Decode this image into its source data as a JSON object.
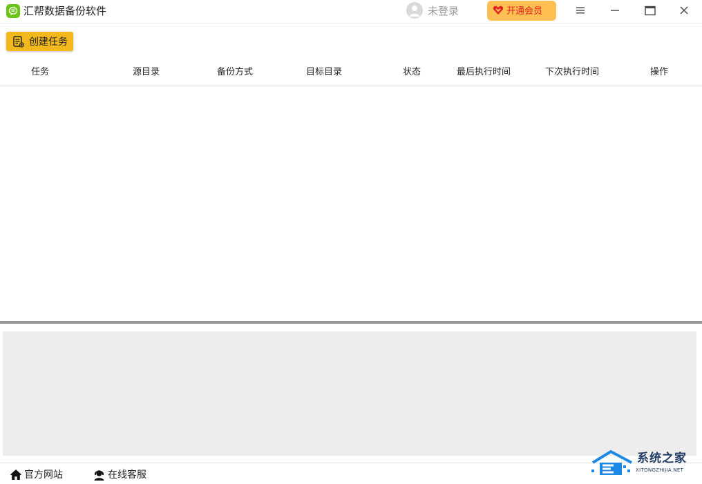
{
  "app": {
    "title": "汇帮数据备份软件"
  },
  "header": {
    "login_text": "未登录",
    "vip_label": "开通会员"
  },
  "toolbar": {
    "create_task_label": "创建任务"
  },
  "table": {
    "columns": [
      "任务",
      "源目录",
      "备份方式",
      "目标目录",
      "状态",
      "最后执行时间",
      "下次执行时间",
      "操作"
    ],
    "rows": []
  },
  "footer": {
    "website_label": "官方网站",
    "support_label": "在线客服"
  },
  "watermark": {
    "text": "系统之家",
    "sub": "XITONGZHIJIA.NET"
  },
  "colors": {
    "accent": "#f2b81c",
    "vip_bg": "#ffbf52",
    "vip_text": "#e02020",
    "logo": "#6cc417"
  }
}
